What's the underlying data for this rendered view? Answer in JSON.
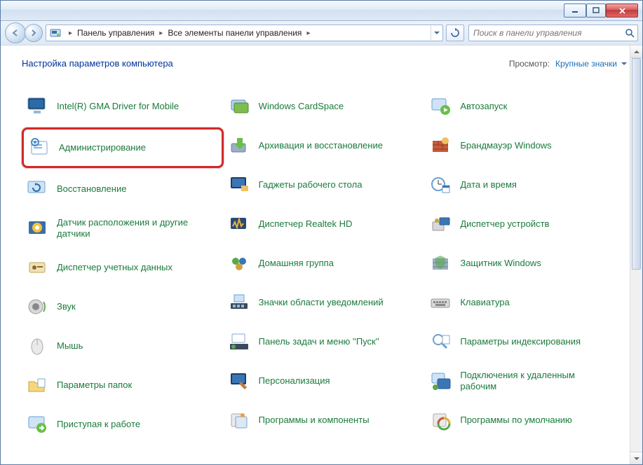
{
  "window": {
    "breadcrumbs": [
      "Панель управления",
      "Все элементы панели управления"
    ],
    "search_placeholder": "Поиск в панели управления"
  },
  "header": {
    "title": "Настройка параметров компьютера",
    "view_label": "Просмотр:",
    "view_value": "Крупные значки"
  },
  "columns": [
    [
      {
        "label": "Intel(R) GMA Driver for Mobile",
        "icon": "monitor",
        "highlight": false
      },
      {
        "label": "Администрирование",
        "icon": "admin",
        "highlight": true
      },
      {
        "label": "Восстановление",
        "icon": "recovery",
        "highlight": false
      },
      {
        "label": "Датчик расположения и другие датчики",
        "icon": "sensor",
        "highlight": false
      },
      {
        "label": "Диспетчер учетных данных",
        "icon": "credentials",
        "highlight": false
      },
      {
        "label": "Звук",
        "icon": "sound",
        "highlight": false
      },
      {
        "label": "Мышь",
        "icon": "mouse",
        "highlight": false
      },
      {
        "label": "Параметры папок",
        "icon": "folder-options",
        "highlight": false
      },
      {
        "label": "Приступая к работе",
        "icon": "getting-started",
        "highlight": false
      }
    ],
    [
      {
        "label": "Windows CardSpace",
        "icon": "cardspace",
        "highlight": false
      },
      {
        "label": "Архивация и восстановление",
        "icon": "backup",
        "highlight": false
      },
      {
        "label": "Гаджеты рабочего стола",
        "icon": "gadgets",
        "highlight": false
      },
      {
        "label": "Диспетчер Realtek HD",
        "icon": "realtek",
        "highlight": false
      },
      {
        "label": "Домашняя группа",
        "icon": "homegroup",
        "highlight": false
      },
      {
        "label": "Значки области уведомлений",
        "icon": "tray",
        "highlight": false
      },
      {
        "label": "Панель задач и меню ''Пуск''",
        "icon": "taskbar",
        "highlight": false
      },
      {
        "label": "Персонализация",
        "icon": "personalize",
        "highlight": false
      },
      {
        "label": "Программы и компоненты",
        "icon": "programs",
        "highlight": false
      }
    ],
    [
      {
        "label": "Автозапуск",
        "icon": "autoplay",
        "highlight": false
      },
      {
        "label": "Брандмауэр Windows",
        "icon": "firewall",
        "highlight": false
      },
      {
        "label": "Дата и время",
        "icon": "datetime",
        "highlight": false
      },
      {
        "label": "Диспетчер устройств",
        "icon": "devmgr",
        "highlight": false
      },
      {
        "label": "Защитник Windows",
        "icon": "defender",
        "highlight": false
      },
      {
        "label": "Клавиатура",
        "icon": "keyboard",
        "highlight": false
      },
      {
        "label": "Параметры индексирования",
        "icon": "indexing",
        "highlight": false
      },
      {
        "label": "Подключения к удаленным рабочим",
        "icon": "remote",
        "highlight": false
      },
      {
        "label": "Программы по умолчанию",
        "icon": "defaults",
        "highlight": false
      }
    ]
  ]
}
